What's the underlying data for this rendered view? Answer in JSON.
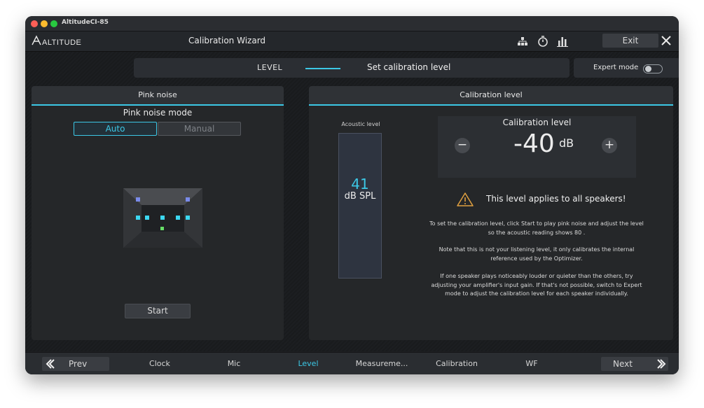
{
  "window": {
    "title": "AltitudeCI-85"
  },
  "header": {
    "brand": "ALTITUDE",
    "title": "Calibration Wizard",
    "exit_label": "Exit"
  },
  "step": {
    "label": "LEVEL",
    "description": "Set calibration level"
  },
  "expert_mode": {
    "label": "Expert mode",
    "enabled": false
  },
  "left_panel": {
    "title": "Pink noise",
    "mode_title": "Pink noise mode",
    "mode_options": [
      "Auto",
      "Manual"
    ],
    "selected_mode": "Auto",
    "start_label": "Start"
  },
  "right_panel": {
    "title": "Calibration level",
    "acoustic_label": "Acoustic level",
    "acoustic_value": "41",
    "acoustic_unit": "dB SPL",
    "calibration_title": "Calibration level",
    "calibration_value": "-40",
    "calibration_unit": "dB",
    "minus_symbol": "−",
    "plus_symbol": "+",
    "warning": "This level applies to all speakers!",
    "paragraphs": [
      "To set the calibration level, click Start to play pink noise and adjust the level so the acoustic reading shows 80 .",
      "Note that this is not your listening level, it only calibrates the internal reference used by the Optimizer.",
      "If one speaker plays noticeably louder or quieter than the others, try adjusting your amplifier's input gain. If that's not possible, switch to Expert mode to adjust the calibration level for each speaker individually."
    ]
  },
  "footer": {
    "prev_label": "Prev",
    "next_label": "Next",
    "tabs": [
      "Clock",
      "Mic",
      "Level",
      "Measureme...",
      "Calibration",
      "WF"
    ],
    "active_tab": "Level"
  },
  "colors": {
    "accent": "#3cc8e6",
    "background": "#1d1f22",
    "panel": "#252729"
  },
  "icons": [
    "network-icon",
    "stopwatch-icon",
    "bar-chart-icon",
    "close-icon",
    "warning-icon",
    "chevron-left-icon",
    "chevron-right-icon"
  ]
}
